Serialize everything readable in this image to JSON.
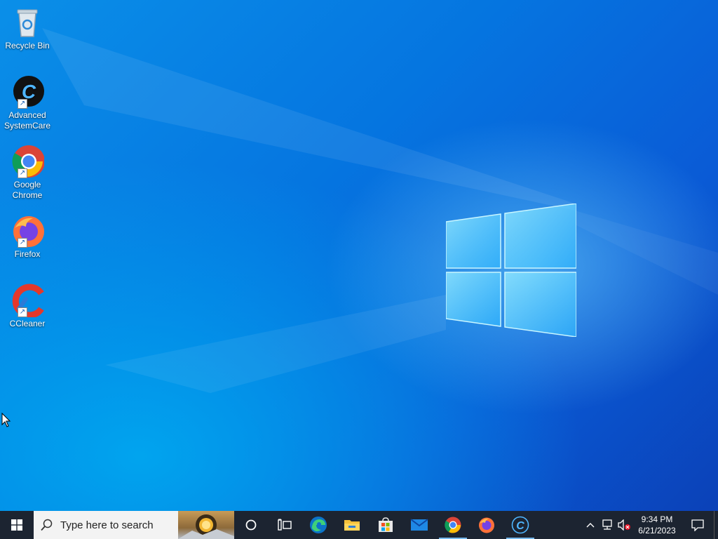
{
  "desktop": {
    "icons": [
      {
        "label": "Recycle Bin",
        "icon": "recycle-bin-icon"
      },
      {
        "label": "Advanced SystemCare",
        "icon": "advanced-systemcare-icon"
      },
      {
        "label": "Google Chrome",
        "icon": "chrome-icon"
      },
      {
        "label": "Firefox",
        "icon": "firefox-icon"
      },
      {
        "label": "CCleaner",
        "icon": "ccleaner-icon"
      }
    ]
  },
  "taskbar": {
    "search_placeholder": "Type here to search",
    "pinned": [
      {
        "name": "cortana",
        "icon": "cortana-circle-icon"
      },
      {
        "name": "task-view",
        "icon": "task-view-icon"
      },
      {
        "name": "edge",
        "icon": "edge-icon"
      },
      {
        "name": "file-explorer",
        "icon": "folder-icon"
      },
      {
        "name": "microsoft-store",
        "icon": "store-icon"
      },
      {
        "name": "mail",
        "icon": "mail-icon"
      },
      {
        "name": "chrome",
        "icon": "chrome-icon"
      },
      {
        "name": "firefox",
        "icon": "firefox-icon"
      },
      {
        "name": "advanced-systemcare",
        "icon": "advanced-systemcare-icon"
      }
    ],
    "clock": {
      "time": "9:34 PM",
      "date": "6/21/2023"
    }
  },
  "colors": {
    "taskbar_bg": "#1c2431",
    "accent": "#76b9ed",
    "desktop_blue": "#0a8fe8"
  }
}
